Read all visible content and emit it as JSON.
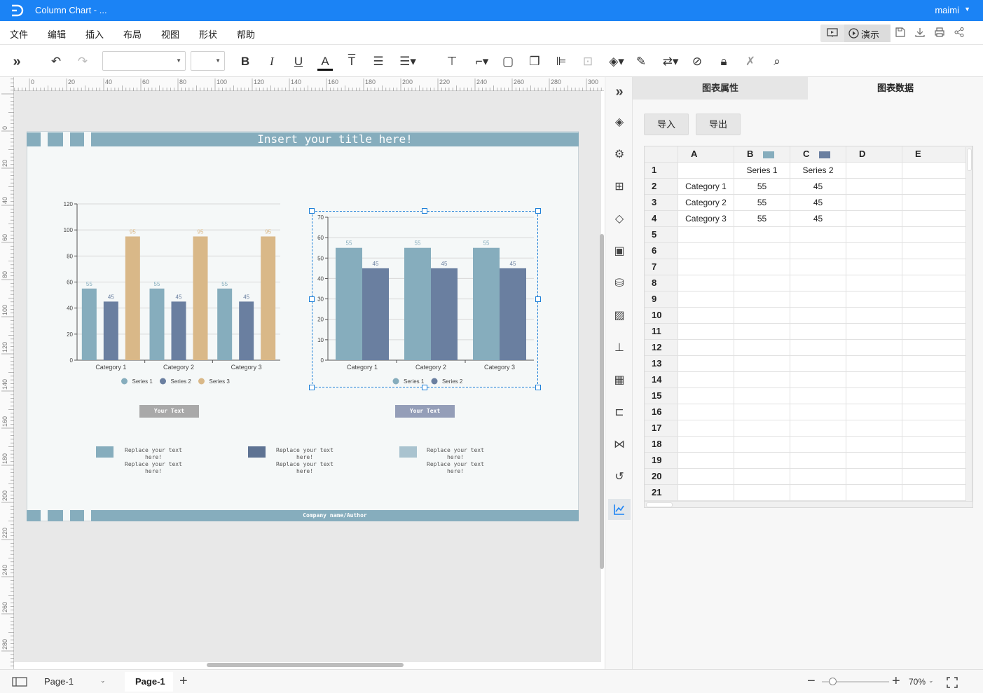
{
  "window": {
    "title": "Column Chart - ...",
    "user": "maimi"
  },
  "menu": [
    "文件",
    "编辑",
    "插入",
    "布局",
    "视图",
    "形状",
    "帮助"
  ],
  "present_label": "演示",
  "ruler_top": [
    "0",
    "20",
    "40",
    "60",
    "80",
    "100",
    "120",
    "140",
    "160",
    "180",
    "200",
    "220",
    "240",
    "260",
    "280",
    "300"
  ],
  "ruler_left": [
    "0",
    "20",
    "40",
    "60",
    "80",
    "100",
    "120",
    "140",
    "160",
    "180",
    "200",
    "220",
    "240",
    "260",
    "280"
  ],
  "page": {
    "title": "Insert your title here!",
    "footer": "Company name/Author",
    "captions": [
      "Your Text",
      "Your Text"
    ],
    "legend_blocks": [
      {
        "color": "#86adbd",
        "lines": [
          "Replace your text",
          "here!",
          "Replace your text",
          "here!"
        ]
      },
      {
        "color": "#5e7393",
        "lines": [
          "Replace your text",
          "here!",
          "Replace your text",
          "here!"
        ]
      },
      {
        "color": "#a9c3cf",
        "lines": [
          "Replace your text",
          "here!",
          "Replace your text",
          "here!"
        ]
      }
    ]
  },
  "chart_data": [
    {
      "type": "bar",
      "categories": [
        "Category 1",
        "Category 2",
        "Category 3"
      ],
      "series": [
        {
          "name": "Series 1",
          "values": [
            55,
            55,
            55
          ],
          "color": "#86adbd"
        },
        {
          "name": "Series 2",
          "values": [
            45,
            45,
            45
          ],
          "color": "#6a7fa0"
        },
        {
          "name": "Series 3",
          "values": [
            95,
            95,
            95
          ],
          "color": "#d9b888"
        }
      ],
      "yticks": [
        "0",
        "20",
        "40",
        "60",
        "80",
        "100",
        "120"
      ],
      "ylim": [
        0,
        120
      ],
      "grid": true,
      "legend": "bottom"
    },
    {
      "type": "bar",
      "categories": [
        "Category 1",
        "Category 2",
        "Category 3"
      ],
      "series": [
        {
          "name": "Series 1",
          "values": [
            55,
            55,
            55
          ],
          "color": "#86adbd"
        },
        {
          "name": "Series 2",
          "values": [
            45,
            45,
            45
          ],
          "color": "#6a7fa0"
        }
      ],
      "yticks": [
        "0",
        "10",
        "20",
        "30",
        "40",
        "50",
        "60",
        "70"
      ],
      "ylim": [
        0,
        70
      ],
      "grid": true,
      "legend": "bottom"
    }
  ],
  "panel": {
    "tabs": [
      "图表属性",
      "图表数据"
    ],
    "active_tab": "图表数据",
    "import_label": "导入",
    "export_label": "导出",
    "columns": [
      "A",
      "B",
      "C",
      "D",
      "E"
    ],
    "column_colors": {
      "B": "#86adbd",
      "C": "#6a7fa0"
    },
    "row_numbers": [
      "1",
      "2",
      "3",
      "4",
      "5",
      "6",
      "7",
      "8",
      "9",
      "10",
      "11",
      "12",
      "13",
      "14",
      "15",
      "16",
      "17",
      "18",
      "19",
      "20",
      "21"
    ],
    "rows": [
      [
        "",
        "Series 1",
        "Series 2",
        "",
        ""
      ],
      [
        "Category 1",
        "55",
        "45",
        "",
        ""
      ],
      [
        "Category 2",
        "55",
        "45",
        "",
        ""
      ],
      [
        "Category 3",
        "55",
        "45",
        "",
        ""
      ]
    ]
  },
  "status": {
    "page_selector": "Page-1",
    "page_tab": "Page-1",
    "zoom": "70%"
  }
}
